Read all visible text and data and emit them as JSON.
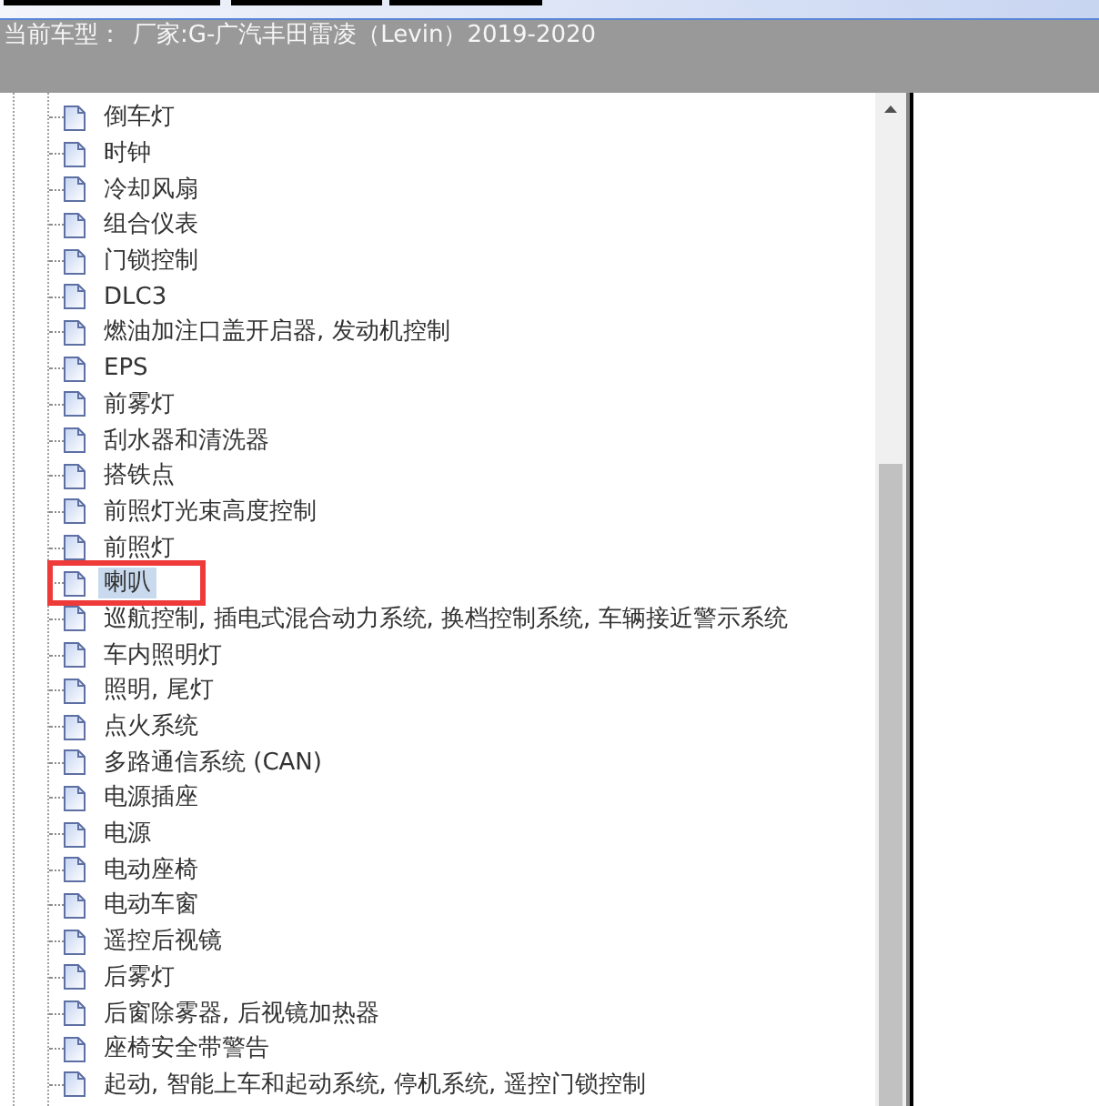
{
  "header": {
    "label": "当前车型：",
    "value": "厂家:G-广汽丰田雷凌（Levin）2019-2020"
  },
  "tree": {
    "items": [
      {
        "label": "倒车灯",
        "selected": false,
        "framed": false
      },
      {
        "label": "时钟",
        "selected": false,
        "framed": false
      },
      {
        "label": "冷却风扇",
        "selected": false,
        "framed": false
      },
      {
        "label": "组合仪表",
        "selected": false,
        "framed": false
      },
      {
        "label": "门锁控制",
        "selected": false,
        "framed": false
      },
      {
        "label": "DLC3",
        "selected": false,
        "framed": false
      },
      {
        "label": "燃油加注口盖开启器, 发动机控制",
        "selected": false,
        "framed": false
      },
      {
        "label": "EPS",
        "selected": false,
        "framed": false
      },
      {
        "label": "前雾灯",
        "selected": false,
        "framed": false
      },
      {
        "label": "刮水器和清洗器",
        "selected": false,
        "framed": false
      },
      {
        "label": "搭铁点",
        "selected": false,
        "framed": false
      },
      {
        "label": "前照灯光束高度控制",
        "selected": false,
        "framed": false
      },
      {
        "label": "前照灯",
        "selected": false,
        "framed": false
      },
      {
        "label": "喇叭",
        "selected": true,
        "framed": true
      },
      {
        "label": "巡航控制, 插电式混合动力系统, 换档控制系统, 车辆接近警示系统",
        "selected": false,
        "framed": false
      },
      {
        "label": "车内照明灯",
        "selected": false,
        "framed": false
      },
      {
        "label": "照明, 尾灯",
        "selected": false,
        "framed": false
      },
      {
        "label": "点火系统",
        "selected": false,
        "framed": false
      },
      {
        "label": "多路通信系统 (CAN)",
        "selected": false,
        "framed": false
      },
      {
        "label": "电源插座",
        "selected": false,
        "framed": false
      },
      {
        "label": "电源",
        "selected": false,
        "framed": false
      },
      {
        "label": "电动座椅",
        "selected": false,
        "framed": false
      },
      {
        "label": "电动车窗",
        "selected": false,
        "framed": false
      },
      {
        "label": "遥控后视镜",
        "selected": false,
        "framed": false
      },
      {
        "label": "后雾灯",
        "selected": false,
        "framed": false
      },
      {
        "label": "后窗除雾器, 后视镜加热器",
        "selected": false,
        "framed": false
      },
      {
        "label": "座椅安全带警告",
        "selected": false,
        "framed": false
      },
      {
        "label": "起动, 智能上车和起动系统, 停机系统, 遥控门锁控制",
        "selected": false,
        "framed": false
      }
    ]
  }
}
